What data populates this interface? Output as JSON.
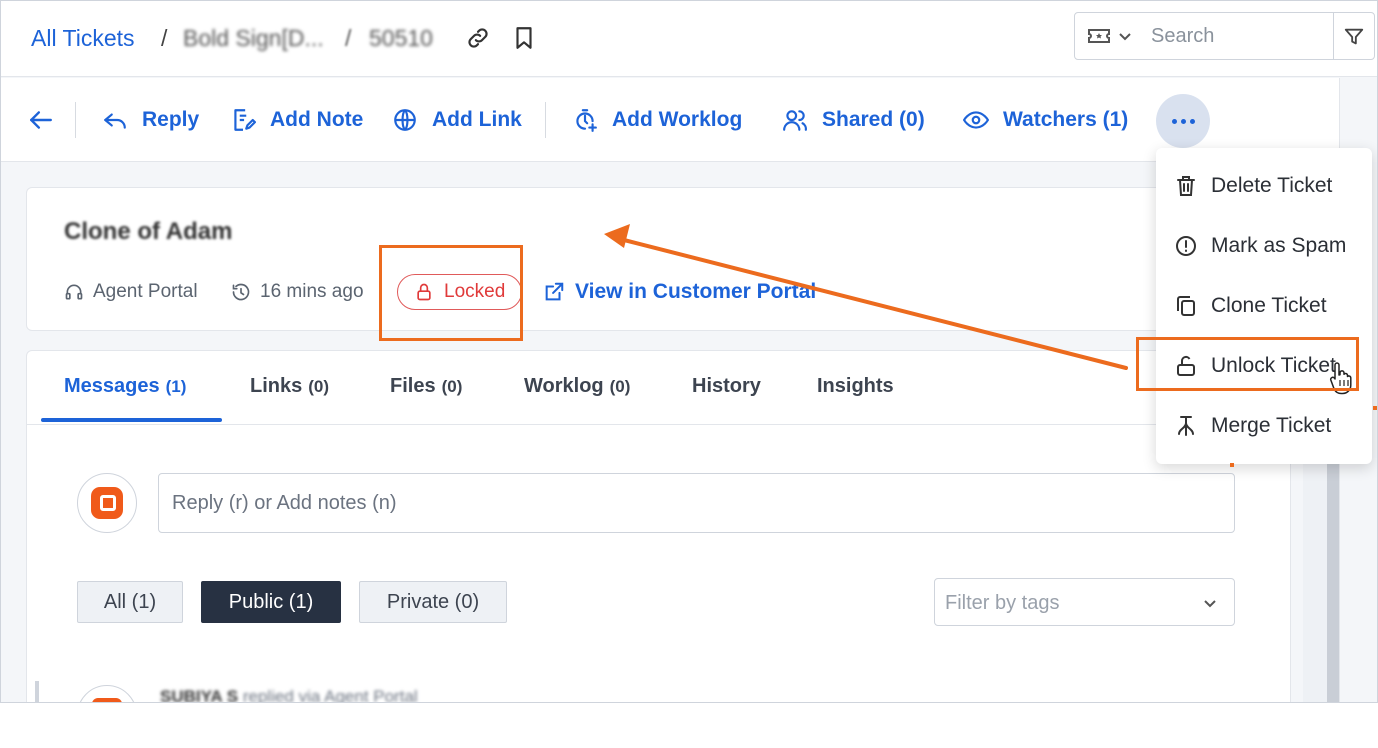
{
  "header": {
    "all_tickets": "All Tickets",
    "separator": "/",
    "ticket_brand": "Bold Sign[D...",
    "ticket_id": "50510",
    "search_placeholder": "Search"
  },
  "toolbar": {
    "reply": "Reply",
    "add_note": "Add Note",
    "add_link": "Add Link",
    "add_worklog": "Add Worklog",
    "shared": "Shared (0)",
    "watchers": "Watchers (1)"
  },
  "ticket": {
    "title": "Clone of Adam",
    "source": "Agent Portal",
    "time_ago": "16 mins ago",
    "status_badge": "Locked",
    "view_portal_link": "View in Customer Portal"
  },
  "tabs": [
    {
      "label": "Messages",
      "count": "(1)",
      "active": true
    },
    {
      "label": "Links",
      "count": "(0)"
    },
    {
      "label": "Files",
      "count": "(0)"
    },
    {
      "label": "Worklog",
      "count": "(0)"
    },
    {
      "label": "History",
      "count": ""
    },
    {
      "label": "Insights",
      "count": ""
    }
  ],
  "composer": {
    "placeholder": "Reply (r) or Add notes (n)"
  },
  "message_filters": {
    "all": "All (1)",
    "public": "Public (1)",
    "private": "Private (0)",
    "tag_placeholder": "Filter by tags"
  },
  "message_preview": {
    "author": "SUBIYA S",
    "action": "replied via Agent Portal"
  },
  "more_menu": {
    "items": [
      {
        "label": "Delete Ticket",
        "icon": "trash-icon"
      },
      {
        "label": "Mark as Spam",
        "icon": "alert-circle-icon"
      },
      {
        "label": "Clone Ticket",
        "icon": "copy-icon"
      },
      {
        "label": "Unlock Ticket",
        "icon": "unlock-icon",
        "highlighted": true
      },
      {
        "label": "Merge Ticket",
        "icon": "merge-icon"
      }
    ]
  },
  "colors": {
    "brand_blue": "#1d63d8",
    "annotation_orange": "#ec6b1e",
    "locked_red": "#e03a3a",
    "active_filter": "#273142"
  }
}
